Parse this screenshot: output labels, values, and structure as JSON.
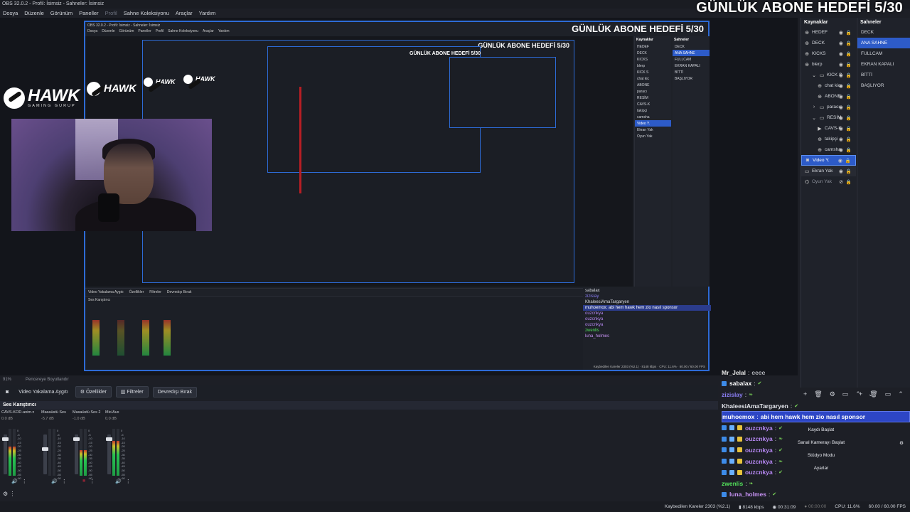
{
  "window_title": "OBS 32.0.2 - Profil: İsimsiz - Sahneler: İsimsiz",
  "menu": [
    "Dosya",
    "Düzenle",
    "Görünüm",
    "Paneller",
    "Profil",
    "Sahne Koleksiyonu",
    "Araçlar",
    "Yardım"
  ],
  "goal_banner": "GÜNLÜK ABONE HEDEFİ 5/30",
  "logo": {
    "name": "HAWK",
    "sub": "GAMING GURUP"
  },
  "sources_panel": {
    "title": "Kaynaklar",
    "items": [
      {
        "label": "HEDEF",
        "icon": "globe-icon"
      },
      {
        "label": "DECK",
        "icon": "globe-icon"
      },
      {
        "label": "KICKS",
        "icon": "globe-icon"
      },
      {
        "label": "blerp",
        "icon": "globe-icon"
      },
      {
        "label": "KICK S",
        "icon": "folder-icon"
      },
      {
        "label": "chat kic",
        "icon": "globe-icon"
      },
      {
        "label": "ABONE",
        "icon": "globe-icon"
      },
      {
        "label": "paracı",
        "icon": "folder-icon"
      },
      {
        "label": "RESİM",
        "icon": "folder-icon"
      },
      {
        "label": "CAVS-K",
        "icon": "play-icon"
      },
      {
        "label": "takipçi",
        "icon": "globe-icon"
      },
      {
        "label": "camsha",
        "icon": "globe-icon"
      },
      {
        "label": "Video Y.",
        "icon": "camera-icon"
      },
      {
        "label": "Ekran Yak",
        "icon": "monitor-icon"
      },
      {
        "label": "Oyun Yak",
        "icon": "gamepad-icon"
      }
    ]
  },
  "scenes_panel": {
    "title": "Sahneler",
    "items": [
      "DECK",
      "ANA SAHNE",
      "FULLCAM",
      "EKRAN KAPALI",
      "BİTTİ",
      "BAŞLIYOR"
    ],
    "selected": "ANA SAHNE"
  },
  "preview_label": "Pencereye Boyutlandır",
  "zoom": "91%",
  "source_toolbar": {
    "source_name": "Video Yakalama Aygıtı",
    "properties": "Özellikler",
    "filters": "Filtreler",
    "deactivate": "Devredışı Bırak"
  },
  "mixer": {
    "title": "Ses Karıştırıcı",
    "channels": [
      {
        "name": "CAVS-KOD-anim.w",
        "db": "0.0 dB",
        "level": 0.62
      },
      {
        "name": "Masaüstü Ses",
        "db": "-5.7 dB",
        "level": 0.0
      },
      {
        "name": "Masaüstü Ses 2",
        "db": "-1.0 dB",
        "level": 0.55
      },
      {
        "name": "Mic/Aux",
        "db": "0.0 dB",
        "level": 0.75
      }
    ],
    "scale": [
      "0",
      "-5",
      "-10",
      "-15",
      "-20",
      "-25",
      "-30",
      "-35",
      "-40",
      "-45",
      "-50",
      "-55",
      "-60"
    ]
  },
  "chat": {
    "messages": [
      {
        "user": "Mr_Jelal",
        "text": "eeee",
        "color": "#e8e8e8",
        "badges": 0
      },
      {
        "user": "sabalax",
        "text": "",
        "color": "#ffffff",
        "badges": 1
      },
      {
        "user": "zizislay",
        "text": "",
        "color": "#8a7df2",
        "badges": 0
      },
      {
        "user": "KhaleesiAmaTargaryen",
        "text": "",
        "color": "#e2e4ea",
        "badges": 0
      },
      {
        "user": "muhoemox",
        "text": "abi hem hawk hem zio nasıl sponsor",
        "color": "#ffffff",
        "badges": 0,
        "highlight": true
      },
      {
        "user": "ouzcnkya",
        "text": "",
        "color": "#b486f0",
        "badges": 3
      },
      {
        "user": "ouzcnkya",
        "text": "",
        "color": "#b486f0",
        "badges": 3
      },
      {
        "user": "ouzcnkya",
        "text": "",
        "color": "#b486f0",
        "badges": 3
      },
      {
        "user": "ouzcnkya",
        "text": "",
        "color": "#b486f0",
        "badges": 3
      },
      {
        "user": "ouzcnkya",
        "text": "",
        "color": "#b486f0",
        "badges": 3
      },
      {
        "user": "zwenlis",
        "text": "",
        "color": "#52e05a",
        "badges": 0
      },
      {
        "user": "luna_holmes",
        "text": "",
        "color": "#c893f5",
        "badges": 1
      }
    ],
    "buttons": [
      "Kaydı Başlat",
      "Sanal Kamerayı Başlat",
      "Stüdyo Modu",
      "Ayarlar"
    ]
  },
  "status": {
    "dropped": "Kaybedilen Kareler 2303 (%2.1)",
    "bitrate": "8148 kbps",
    "live_time": "00:31:09",
    "rec_time": "00:00:00",
    "cpu": "CPU: 11.6%",
    "fps": "60.00 / 60.00 FPS"
  },
  "colors": {
    "accent": "#2d5bc8",
    "selection_border": "#2d6bd6",
    "bg": "#1d1f26"
  }
}
